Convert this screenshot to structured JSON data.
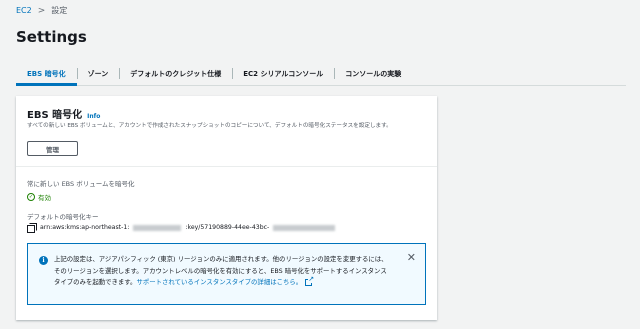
{
  "breadcrumb": {
    "root": "EC2",
    "separator": ">",
    "current": "設定"
  },
  "page": {
    "title": "Settings"
  },
  "tabs": [
    {
      "label": "EBS 暗号化",
      "active": true
    },
    {
      "label": "ゾーン",
      "active": false
    },
    {
      "label": "デフォルトのクレジット仕様",
      "active": false
    },
    {
      "label": "EC2 シリアルコンソール",
      "active": false
    },
    {
      "label": "コンソールの実験",
      "active": false
    }
  ],
  "card": {
    "title": "EBS 暗号化",
    "info": "Info",
    "description": "すべての新しい EBS ボリュームと、アカウントで作成されたスナップショットのコピーについて、デフォルトの暗号化ステータスを設定します。",
    "manage_label": "管理",
    "always_encrypt_label": "常に新しい EBS ボリュームを暗号化",
    "status_text": "有効",
    "default_key_label": "デフォルトの暗号化キー",
    "key_prefix": "arn:aws:kms:ap-northeast-1:",
    "key_mid": ":key/57190889-44ee-43bc-"
  },
  "alert": {
    "text": "上記の設定は、アジアパシフィック (東京) リージョンのみに適用されます。他のリージョンの設定を変更するには、そのリージョンを選択します。アカウントレベルの暗号化を有効にすると、EBS 暗号化をサポートするインスタンスタイプのみを起動できます。",
    "link": "サポートされているインスタンスタイプの詳細はこちら。"
  },
  "colors": {
    "accent": "#0073bb",
    "success": "#1d8102",
    "alert_bg": "#f1faff"
  },
  "icons": {
    "status": "check-circle-icon",
    "copy": "copy-icon",
    "alert": "info-icon",
    "close": "close-icon",
    "external": "external-link-icon"
  }
}
